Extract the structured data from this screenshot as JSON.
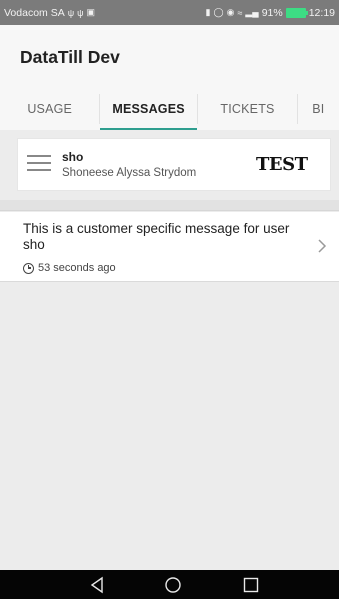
{
  "status_bar": {
    "carrier": "Vodacom SA",
    "battery": "91%",
    "time": "12:19"
  },
  "app": {
    "title": "DataTill Dev"
  },
  "tabs": [
    {
      "label": "USAGE",
      "active": false
    },
    {
      "label": "MESSAGES",
      "active": true
    },
    {
      "label": "TICKETS",
      "active": false
    },
    {
      "label": "BI",
      "active": false
    }
  ],
  "user_card": {
    "username": "sho",
    "full_name": "Shoneese Alyssa Strydom",
    "environment": "TEST"
  },
  "messages": [
    {
      "text": "This is a customer specific message for user sho",
      "time": "53 seconds ago"
    }
  ],
  "colors": {
    "accent": "#2e9e8f",
    "status_bar": "#7b7b7b",
    "nav_bar": "#050505",
    "battery": "#3ddc84"
  },
  "icons": {
    "menu": "hamburger-icon",
    "clock": "clock-icon",
    "chevron": "chevron-right-icon",
    "back": "back-triangle-icon",
    "home": "home-circle-icon",
    "recent": "recent-square-icon"
  }
}
